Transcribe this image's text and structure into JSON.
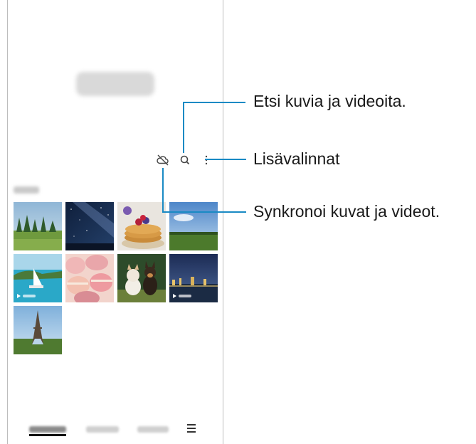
{
  "gallery": {
    "play_icon": "play-icon",
    "bottom_nav": {
      "menu_icon": "hamburger-menu-icon"
    },
    "toolbar": {
      "cloud_icon": "cloud-off-icon",
      "search_icon": "search-icon",
      "more_icon": "more-vertical-icon"
    }
  },
  "callouts": [
    {
      "text": "Etsi kuvia ja videoita."
    },
    {
      "text": "Lisävalinnat"
    },
    {
      "text": "Synkronoi kuvat ja videot."
    }
  ],
  "colors": {
    "callout_line": "#1a8ac4"
  }
}
